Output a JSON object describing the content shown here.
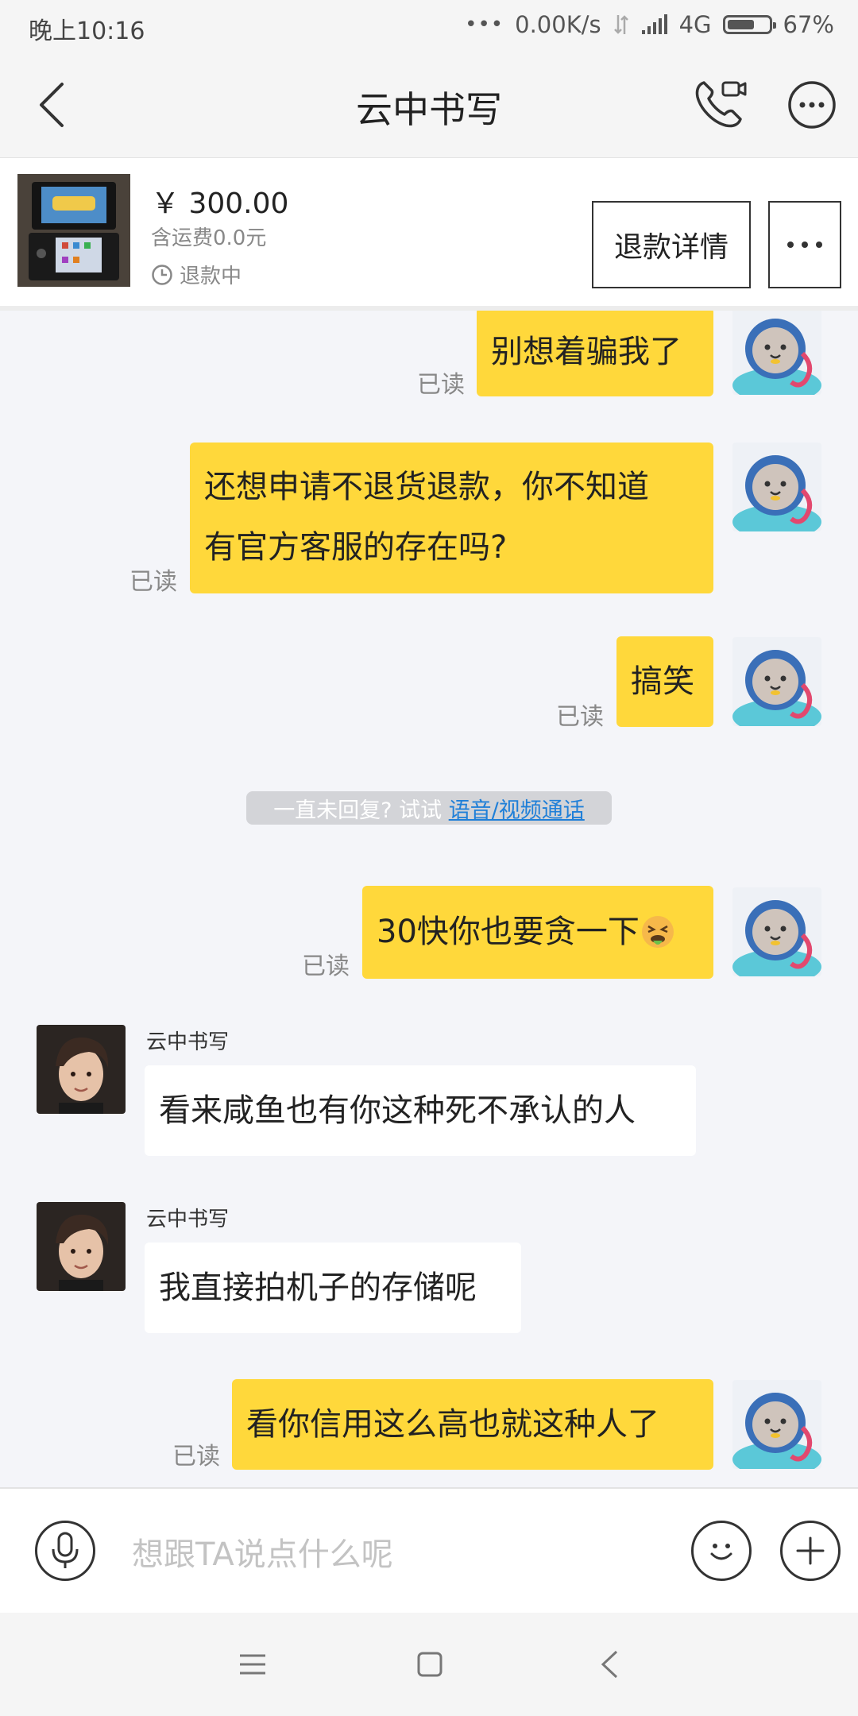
{
  "status_bar": {
    "time": "晚上10:16",
    "network_speed": "0.00K/s",
    "network_type": "4G",
    "battery": "67%",
    "battery_level": 0.67
  },
  "header": {
    "title": "云中书写",
    "back_icon": "chevron-left-icon",
    "call_icon": "phone-video-icon",
    "more_icon": "more-circle-icon"
  },
  "product": {
    "price": "￥ 300.00",
    "shipping": "含运费0.0元",
    "status": "退款中",
    "refund_button": "退款详情"
  },
  "messages": [
    {
      "from": "me",
      "text": "别想着骗我了",
      "status": "已读"
    },
    {
      "from": "me",
      "text_line1": "还想申请不退货退款，你不知道",
      "text_line2": "有官方客服的存在吗?",
      "status": "已读"
    },
    {
      "from": "me",
      "text": "搞笑",
      "status": "已读"
    },
    {
      "from": "me",
      "text": "30快你也要贪一下",
      "status": "已读"
    },
    {
      "from": "them",
      "name": "云中书写",
      "text": "看来咸鱼也有你这种死不承认的人"
    },
    {
      "from": "them",
      "name": "云中书写",
      "text": "我直接拍机子的存储呢"
    },
    {
      "from": "me",
      "text": "看你信用这么高也就这种人了",
      "status": "已读"
    }
  ],
  "hint": {
    "prefix": "一直未回复? 试试 ",
    "link": "语音/视频通话"
  },
  "input": {
    "placeholder": "想跟TA说点什么呢"
  },
  "colors": {
    "my_bubble": "#ffd83b",
    "their_bubble": "#ffffff",
    "background": "#f4f5f9",
    "link": "#1f7fd8"
  }
}
